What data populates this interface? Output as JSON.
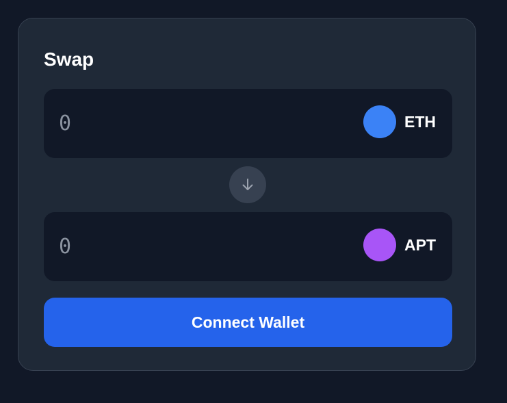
{
  "swap": {
    "title": "Swap",
    "from": {
      "placeholder": "0",
      "token_symbol": "ETH",
      "token_color": "#3b82f6",
      "token_icon": "eth-token-icon"
    },
    "to": {
      "placeholder": "0",
      "token_symbol": "APT",
      "token_color": "#a855f7",
      "token_icon": "apt-token-icon"
    },
    "switch_icon": "arrow-down-icon",
    "connect_label": "Connect Wallet"
  },
  "colors": {
    "background": "#111827",
    "card": "#1f2937",
    "input_bg": "#111827",
    "accent": "#2563eb",
    "switch_bg": "#374151"
  }
}
